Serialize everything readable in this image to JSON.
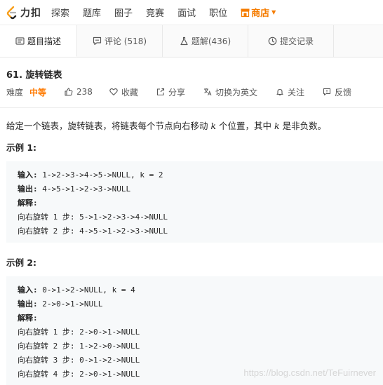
{
  "nav": {
    "logo_text": "力扣",
    "items": [
      "探索",
      "题库",
      "圈子",
      "竞赛",
      "面试",
      "职位"
    ],
    "store": "商店"
  },
  "tabs": [
    {
      "label": "题目描述",
      "icon": "description-icon",
      "active": true
    },
    {
      "label": "评论 (518)",
      "icon": "comment-icon",
      "active": false
    },
    {
      "label": "题解(436)",
      "icon": "flask-icon",
      "active": false
    },
    {
      "label": "提交记录",
      "icon": "clock-icon",
      "active": false
    }
  ],
  "problem": {
    "title": "61. 旋转链表",
    "difficulty_label": "难度",
    "difficulty": "中等",
    "likes": "238",
    "favorite": "收藏",
    "share": "分享",
    "switch_lang": "切换为英文",
    "follow": "关注",
    "feedback": "反馈",
    "desc_pre": "给定一个链表，旋转链表，将链表每个节点向右移动 ",
    "desc_k1": "k",
    "desc_mid": " 个位置，其中 ",
    "desc_k2": "k",
    "desc_post": " 是非负数。"
  },
  "examples": [
    {
      "title": "示例 1:",
      "input_label": "输入",
      "input": "1->2->3->4->5->NULL, k = 2",
      "output_label": "输出",
      "output": "4->5->1->2->3->NULL",
      "explain_label": "解释",
      "steps": [
        "向右旋转 1 步: 5->1->2->3->4->NULL",
        "向右旋转 2 步: 4->5->1->2->3->NULL"
      ]
    },
    {
      "title": "示例 2:",
      "input_label": "输入",
      "input": "0->1->2->NULL, k = 4",
      "output_label": "输出",
      "output": "2->0->1->NULL",
      "explain_label": "解释",
      "steps": [
        "向右旋转 1 步: 2->0->1->NULL",
        "向右旋转 2 步: 1->2->0->NULL",
        "向右旋转 3 步: 0->1->2->NULL",
        "向右旋转 4 步: 2->0->1->NULL"
      ]
    }
  ],
  "watermark": "https://blog.csdn.net/TeFuirnever",
  "colors": {
    "accent": "#ff7a00",
    "code_bg": "#f7f9fa"
  }
}
